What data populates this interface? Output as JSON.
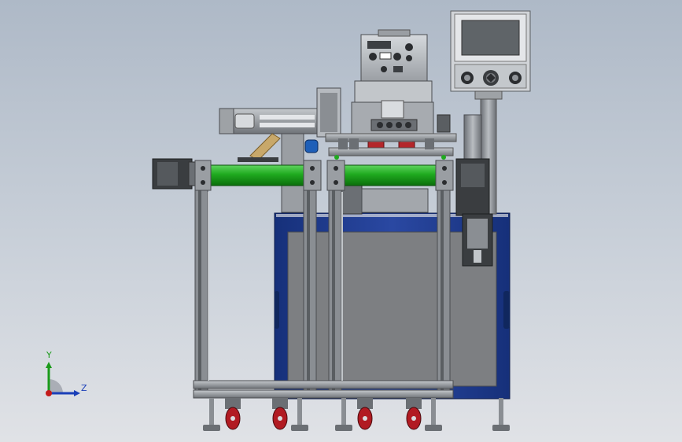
{
  "scene": {
    "subject": "pad-printing-machine-with-conveyor",
    "colors": {
      "background_top": "#aeb9c7",
      "background_bottom": "#e0e2e6",
      "cabinet_frame": "#1e3a8a",
      "cabinet_panel": "#7d7f82",
      "roller_green": "#1faa1f",
      "frame_profile": "#8a8e93",
      "cup_red": "#b3262a",
      "caster_red": "#b11b22",
      "hmi_screen": "#5f6468",
      "motor_dark": "#3a3d40"
    },
    "icons": [
      "coordinate-triad-icon",
      "hmi-knob-icon",
      "emergency-stop-icon"
    ]
  },
  "triad": {
    "y_label": "Y",
    "z_label": "Z"
  }
}
